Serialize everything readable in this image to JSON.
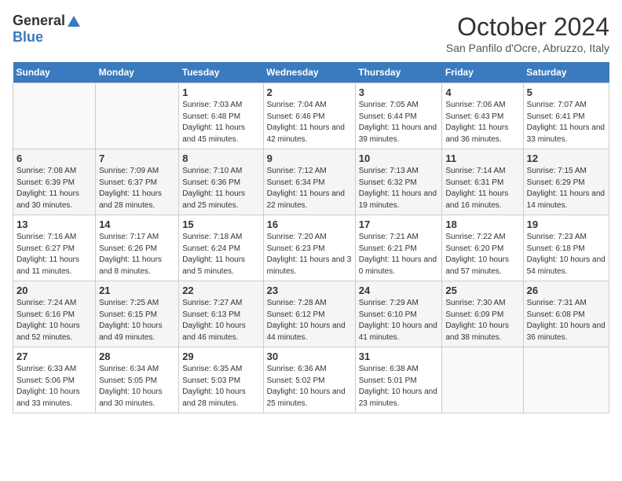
{
  "header": {
    "logo_general": "General",
    "logo_blue": "Blue",
    "month": "October 2024",
    "location": "San Panfilo d'Ocre, Abruzzo, Italy"
  },
  "days_of_week": [
    "Sunday",
    "Monday",
    "Tuesday",
    "Wednesday",
    "Thursday",
    "Friday",
    "Saturday"
  ],
  "weeks": [
    [
      {
        "day": "",
        "info": ""
      },
      {
        "day": "",
        "info": ""
      },
      {
        "day": "1",
        "info": "Sunrise: 7:03 AM\nSunset: 6:48 PM\nDaylight: 11 hours and 45 minutes."
      },
      {
        "day": "2",
        "info": "Sunrise: 7:04 AM\nSunset: 6:46 PM\nDaylight: 11 hours and 42 minutes."
      },
      {
        "day": "3",
        "info": "Sunrise: 7:05 AM\nSunset: 6:44 PM\nDaylight: 11 hours and 39 minutes."
      },
      {
        "day": "4",
        "info": "Sunrise: 7:06 AM\nSunset: 6:43 PM\nDaylight: 11 hours and 36 minutes."
      },
      {
        "day": "5",
        "info": "Sunrise: 7:07 AM\nSunset: 6:41 PM\nDaylight: 11 hours and 33 minutes."
      }
    ],
    [
      {
        "day": "6",
        "info": "Sunrise: 7:08 AM\nSunset: 6:39 PM\nDaylight: 11 hours and 30 minutes."
      },
      {
        "day": "7",
        "info": "Sunrise: 7:09 AM\nSunset: 6:37 PM\nDaylight: 11 hours and 28 minutes."
      },
      {
        "day": "8",
        "info": "Sunrise: 7:10 AM\nSunset: 6:36 PM\nDaylight: 11 hours and 25 minutes."
      },
      {
        "day": "9",
        "info": "Sunrise: 7:12 AM\nSunset: 6:34 PM\nDaylight: 11 hours and 22 minutes."
      },
      {
        "day": "10",
        "info": "Sunrise: 7:13 AM\nSunset: 6:32 PM\nDaylight: 11 hours and 19 minutes."
      },
      {
        "day": "11",
        "info": "Sunrise: 7:14 AM\nSunset: 6:31 PM\nDaylight: 11 hours and 16 minutes."
      },
      {
        "day": "12",
        "info": "Sunrise: 7:15 AM\nSunset: 6:29 PM\nDaylight: 11 hours and 14 minutes."
      }
    ],
    [
      {
        "day": "13",
        "info": "Sunrise: 7:16 AM\nSunset: 6:27 PM\nDaylight: 11 hours and 11 minutes."
      },
      {
        "day": "14",
        "info": "Sunrise: 7:17 AM\nSunset: 6:26 PM\nDaylight: 11 hours and 8 minutes."
      },
      {
        "day": "15",
        "info": "Sunrise: 7:18 AM\nSunset: 6:24 PM\nDaylight: 11 hours and 5 minutes."
      },
      {
        "day": "16",
        "info": "Sunrise: 7:20 AM\nSunset: 6:23 PM\nDaylight: 11 hours and 3 minutes."
      },
      {
        "day": "17",
        "info": "Sunrise: 7:21 AM\nSunset: 6:21 PM\nDaylight: 11 hours and 0 minutes."
      },
      {
        "day": "18",
        "info": "Sunrise: 7:22 AM\nSunset: 6:20 PM\nDaylight: 10 hours and 57 minutes."
      },
      {
        "day": "19",
        "info": "Sunrise: 7:23 AM\nSunset: 6:18 PM\nDaylight: 10 hours and 54 minutes."
      }
    ],
    [
      {
        "day": "20",
        "info": "Sunrise: 7:24 AM\nSunset: 6:16 PM\nDaylight: 10 hours and 52 minutes."
      },
      {
        "day": "21",
        "info": "Sunrise: 7:25 AM\nSunset: 6:15 PM\nDaylight: 10 hours and 49 minutes."
      },
      {
        "day": "22",
        "info": "Sunrise: 7:27 AM\nSunset: 6:13 PM\nDaylight: 10 hours and 46 minutes."
      },
      {
        "day": "23",
        "info": "Sunrise: 7:28 AM\nSunset: 6:12 PM\nDaylight: 10 hours and 44 minutes."
      },
      {
        "day": "24",
        "info": "Sunrise: 7:29 AM\nSunset: 6:10 PM\nDaylight: 10 hours and 41 minutes."
      },
      {
        "day": "25",
        "info": "Sunrise: 7:30 AM\nSunset: 6:09 PM\nDaylight: 10 hours and 38 minutes."
      },
      {
        "day": "26",
        "info": "Sunrise: 7:31 AM\nSunset: 6:08 PM\nDaylight: 10 hours and 36 minutes."
      }
    ],
    [
      {
        "day": "27",
        "info": "Sunrise: 6:33 AM\nSunset: 5:06 PM\nDaylight: 10 hours and 33 minutes."
      },
      {
        "day": "28",
        "info": "Sunrise: 6:34 AM\nSunset: 5:05 PM\nDaylight: 10 hours and 30 minutes."
      },
      {
        "day": "29",
        "info": "Sunrise: 6:35 AM\nSunset: 5:03 PM\nDaylight: 10 hours and 28 minutes."
      },
      {
        "day": "30",
        "info": "Sunrise: 6:36 AM\nSunset: 5:02 PM\nDaylight: 10 hours and 25 minutes."
      },
      {
        "day": "31",
        "info": "Sunrise: 6:38 AM\nSunset: 5:01 PM\nDaylight: 10 hours and 23 minutes."
      },
      {
        "day": "",
        "info": ""
      },
      {
        "day": "",
        "info": ""
      }
    ]
  ]
}
